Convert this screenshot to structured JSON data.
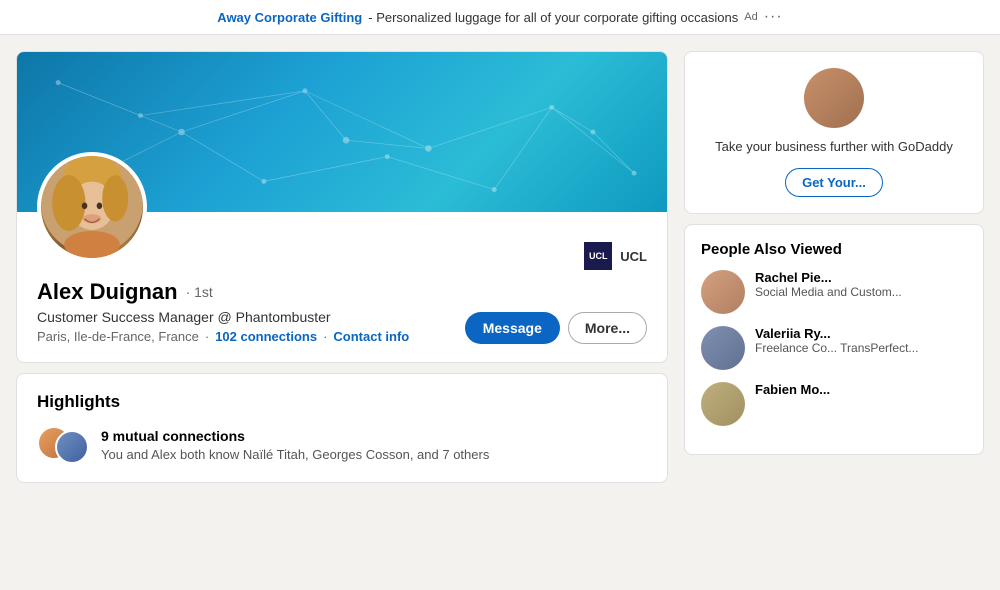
{
  "adBar": {
    "brand": "Away Corporate Gifting",
    "text": " - Personalized luggage for all of your corporate gifting occasions",
    "adLabel": "Ad",
    "more": "···"
  },
  "profile": {
    "name": "Alex Duignan",
    "degree": "· 1st",
    "title": "Customer Success Manager @ Phantombuster",
    "location": "Paris, Ile-de-France, France",
    "connections": "102 connections",
    "contactInfo": "Contact info",
    "education": "UCL",
    "messageBtn": "Message",
    "moreBtn": "More..."
  },
  "highlights": {
    "title": "Highlights",
    "mutualCount": "9 mutual connections",
    "mutualDesc": "You and Alex both know Naïlé Titah, Georges Cosson, and 7 others"
  },
  "sidebar": {
    "adText": "Take your business further with GoDaddy",
    "adBoldText": "GoDaddy",
    "getBtn": "Get Your...",
    "peopleAlsoViewed": "People Also Viewed",
    "people": [
      {
        "name": "Rachel Pie...",
        "role": "Social Media and Custom..."
      },
      {
        "name": "Valeriia Ry...",
        "role": "Freelance Co... TransPerfect..."
      },
      {
        "name": "Fabien Mo...",
        "role": ""
      }
    ]
  }
}
